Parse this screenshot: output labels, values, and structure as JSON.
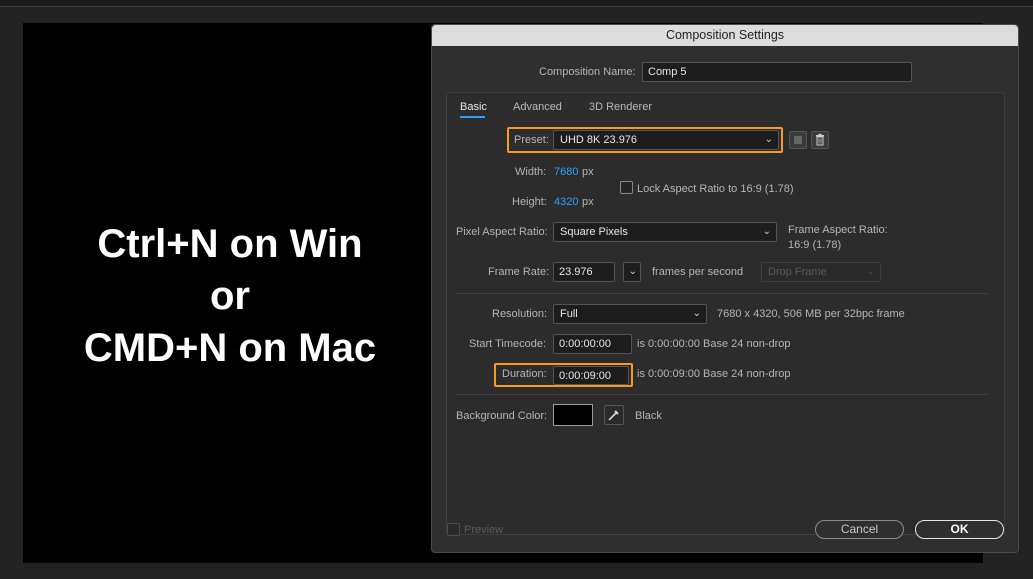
{
  "overlay": {
    "line1": "Ctrl+N on Win",
    "line2": "or",
    "line3": "CMD+N on Mac"
  },
  "dialog": {
    "title": "Composition Settings",
    "comp_name_label": "Composition Name:",
    "comp_name_value": "Comp 5",
    "tabs": [
      {
        "label": "Basic",
        "active": true
      },
      {
        "label": "Advanced",
        "active": false
      },
      {
        "label": "3D Renderer",
        "active": false
      }
    ],
    "preset_label": "Preset:",
    "preset_value": "UHD 8K 23.976",
    "width_label": "Width:",
    "width_value": "7680",
    "width_unit": "px",
    "height_label": "Height:",
    "height_value": "4320",
    "height_unit": "px",
    "lock_aspect_label": "Lock Aspect Ratio to 16:9 (1.78)",
    "pixel_aspect_label": "Pixel Aspect Ratio:",
    "pixel_aspect_value": "Square Pixels",
    "frame_aspect_label": "Frame Aspect Ratio:",
    "frame_aspect_value": "16:9 (1.78)",
    "frame_rate_label": "Frame Rate:",
    "frame_rate_value": "23.976",
    "frames_per_second": "frames per second",
    "drop_frame_value": "Drop Frame",
    "resolution_label": "Resolution:",
    "resolution_value": "Full",
    "resolution_info": "7680 x 4320, 506 MB per 32bpc frame",
    "start_timecode_label": "Start Timecode:",
    "start_timecode_value": "0:00:00:00",
    "start_timecode_info": "is 0:00:00:00  Base 24  non-drop",
    "duration_label": "Duration:",
    "duration_value": "0:00:09:00",
    "duration_info": "is 0:00:09:00  Base 24  non-drop",
    "bg_color_label": "Background Color:",
    "bg_color_hex": "#000000",
    "bg_color_name": "Black",
    "preview_label": "Preview",
    "cancel_label": "Cancel",
    "ok_label": "OK"
  },
  "colors": {
    "highlight": "#f59a23",
    "accent_blue": "#2ea1ff",
    "dialog_bg": "#2f2f2f"
  },
  "icons": [
    "chevron-down-icon",
    "save-preset-icon",
    "trash-icon",
    "eyedropper-icon",
    "checkbox-icon"
  ]
}
